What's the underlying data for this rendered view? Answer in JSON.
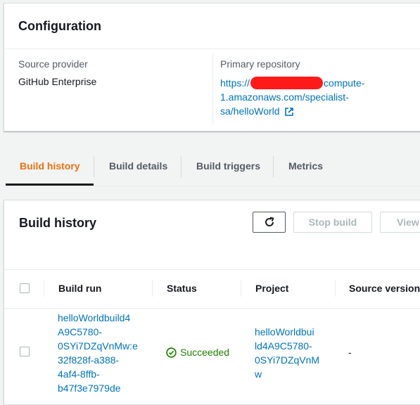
{
  "configuration": {
    "title": "Configuration",
    "source_provider_label": "Source provider",
    "source_provider_value": "GitHub Enterprise",
    "primary_repository_label": "Primary repository",
    "repo_link_prefix": "https://",
    "repo_link_suffix": "compute-1.amazonaws.com/specialist-sa/helloWorld"
  },
  "tabs": [
    {
      "label": "Build history",
      "active": true
    },
    {
      "label": "Build details",
      "active": false
    },
    {
      "label": "Build triggers",
      "active": false
    },
    {
      "label": "Metrics",
      "active": false
    }
  ],
  "build_history": {
    "title": "Build history",
    "refresh_icon": "refresh-icon",
    "stop_build_label": "Stop build",
    "view_label": "View",
    "columns": [
      "Build run",
      "Status",
      "Project",
      "Source version"
    ],
    "rows": [
      {
        "build_run": "helloWorldbuild4A9C5780-0SYi7DZqVnMw:e32f828f-a388-4af4-8ffb-b47f3e7979de",
        "build_run_lines": [
          "helloWorldbuild4",
          "A9C5780-",
          "0SYi7DZqVnMw:e",
          "32f828f-a388-",
          "4af4-8ffb-",
          "b47f3e7979de"
        ],
        "status": "Succeeded",
        "status_icon": "check-circle-icon",
        "project": "helloWorldbuild4A9C5780-0SYi7DZqVnMw",
        "project_lines": [
          "helloWorldbui",
          "ld4A9C5780-",
          "0SYi7DZqVnM",
          "w"
        ],
        "source_version": "-"
      }
    ]
  },
  "colors": {
    "accent_orange": "#ec7211",
    "link_blue": "#0073bb",
    "success_green": "#1d8102",
    "redaction_red": "#ff1a1a"
  }
}
